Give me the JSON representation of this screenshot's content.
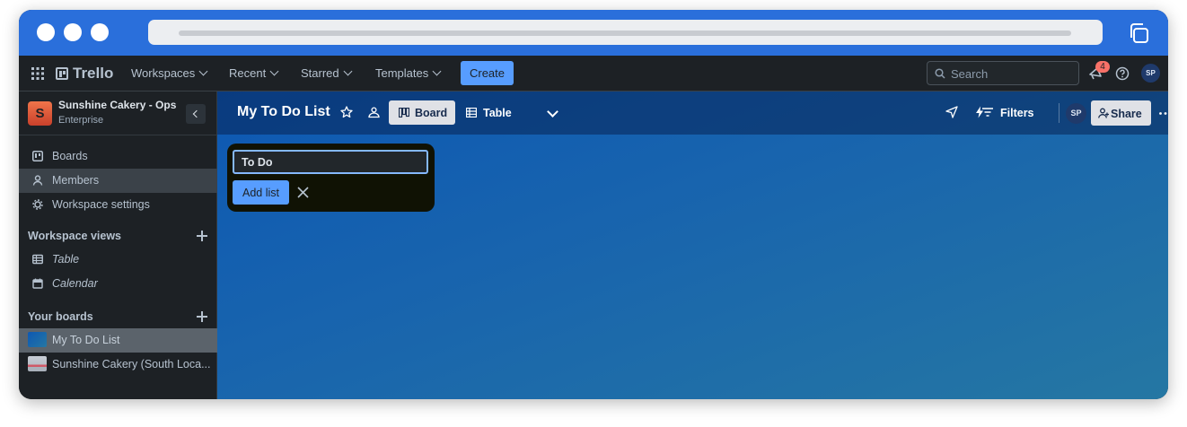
{
  "topnav": {
    "brand": "Trello",
    "menus": [
      {
        "label": "Workspaces"
      },
      {
        "label": "Recent"
      },
      {
        "label": "Starred"
      },
      {
        "label": "Templates"
      }
    ],
    "create_label": "Create",
    "search_placeholder": "Search",
    "notification_count": "4",
    "user_initials": "SP"
  },
  "sidebar": {
    "workspace": {
      "initial": "S",
      "name": "Sunshine Cakery - Ops",
      "plan": "Enterprise"
    },
    "nav": [
      {
        "label": "Boards",
        "icon": "board-icon"
      },
      {
        "label": "Members",
        "icon": "person-icon",
        "active": true
      },
      {
        "label": "Workspace settings",
        "icon": "gear-icon"
      }
    ],
    "views_heading": "Workspace views",
    "views": [
      {
        "label": "Table",
        "icon": "table-icon"
      },
      {
        "label": "Calendar",
        "icon": "calendar-icon"
      }
    ],
    "boards_heading": "Your boards",
    "boards": [
      {
        "label": "My To Do List",
        "active": true
      },
      {
        "label": "Sunshine Cakery (South Loca..."
      }
    ]
  },
  "board": {
    "title": "My To Do List",
    "views": [
      {
        "label": "Board",
        "active": true
      },
      {
        "label": "Table"
      }
    ],
    "filters_label": "Filters",
    "member_initials": "SP",
    "share_label": "Share"
  },
  "composer": {
    "input_value": "To Do",
    "add_label": "Add list"
  },
  "colors": {
    "accent": "#579dff",
    "chrome": "#2a6fdb",
    "nav_bg": "#1d2125",
    "board_gradient_start": "#0d58b3",
    "board_gradient_end": "#2577a3",
    "badge": "#f87168"
  }
}
